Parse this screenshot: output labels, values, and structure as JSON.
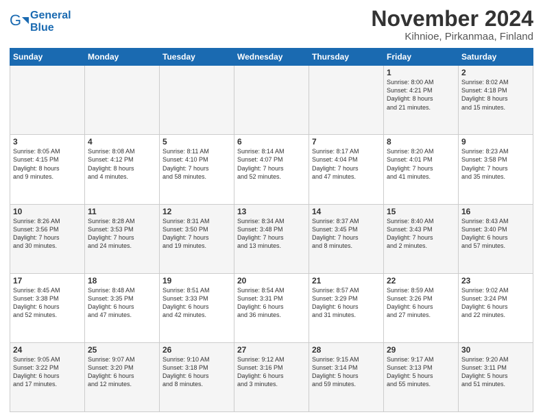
{
  "header": {
    "logo_line1": "General",
    "logo_line2": "Blue",
    "title": "November 2024",
    "subtitle": "Kihnioe, Pirkanmaa, Finland"
  },
  "weekdays": [
    "Sunday",
    "Monday",
    "Tuesday",
    "Wednesday",
    "Thursday",
    "Friday",
    "Saturday"
  ],
  "weeks": [
    [
      {
        "day": "",
        "info": ""
      },
      {
        "day": "",
        "info": ""
      },
      {
        "day": "",
        "info": ""
      },
      {
        "day": "",
        "info": ""
      },
      {
        "day": "",
        "info": ""
      },
      {
        "day": "1",
        "info": "Sunrise: 8:00 AM\nSunset: 4:21 PM\nDaylight: 8 hours\nand 21 minutes."
      },
      {
        "day": "2",
        "info": "Sunrise: 8:02 AM\nSunset: 4:18 PM\nDaylight: 8 hours\nand 15 minutes."
      }
    ],
    [
      {
        "day": "3",
        "info": "Sunrise: 8:05 AM\nSunset: 4:15 PM\nDaylight: 8 hours\nand 9 minutes."
      },
      {
        "day": "4",
        "info": "Sunrise: 8:08 AM\nSunset: 4:12 PM\nDaylight: 8 hours\nand 4 minutes."
      },
      {
        "day": "5",
        "info": "Sunrise: 8:11 AM\nSunset: 4:10 PM\nDaylight: 7 hours\nand 58 minutes."
      },
      {
        "day": "6",
        "info": "Sunrise: 8:14 AM\nSunset: 4:07 PM\nDaylight: 7 hours\nand 52 minutes."
      },
      {
        "day": "7",
        "info": "Sunrise: 8:17 AM\nSunset: 4:04 PM\nDaylight: 7 hours\nand 47 minutes."
      },
      {
        "day": "8",
        "info": "Sunrise: 8:20 AM\nSunset: 4:01 PM\nDaylight: 7 hours\nand 41 minutes."
      },
      {
        "day": "9",
        "info": "Sunrise: 8:23 AM\nSunset: 3:58 PM\nDaylight: 7 hours\nand 35 minutes."
      }
    ],
    [
      {
        "day": "10",
        "info": "Sunrise: 8:26 AM\nSunset: 3:56 PM\nDaylight: 7 hours\nand 30 minutes."
      },
      {
        "day": "11",
        "info": "Sunrise: 8:28 AM\nSunset: 3:53 PM\nDaylight: 7 hours\nand 24 minutes."
      },
      {
        "day": "12",
        "info": "Sunrise: 8:31 AM\nSunset: 3:50 PM\nDaylight: 7 hours\nand 19 minutes."
      },
      {
        "day": "13",
        "info": "Sunrise: 8:34 AM\nSunset: 3:48 PM\nDaylight: 7 hours\nand 13 minutes."
      },
      {
        "day": "14",
        "info": "Sunrise: 8:37 AM\nSunset: 3:45 PM\nDaylight: 7 hours\nand 8 minutes."
      },
      {
        "day": "15",
        "info": "Sunrise: 8:40 AM\nSunset: 3:43 PM\nDaylight: 7 hours\nand 2 minutes."
      },
      {
        "day": "16",
        "info": "Sunrise: 8:43 AM\nSunset: 3:40 PM\nDaylight: 6 hours\nand 57 minutes."
      }
    ],
    [
      {
        "day": "17",
        "info": "Sunrise: 8:45 AM\nSunset: 3:38 PM\nDaylight: 6 hours\nand 52 minutes."
      },
      {
        "day": "18",
        "info": "Sunrise: 8:48 AM\nSunset: 3:35 PM\nDaylight: 6 hours\nand 47 minutes."
      },
      {
        "day": "19",
        "info": "Sunrise: 8:51 AM\nSunset: 3:33 PM\nDaylight: 6 hours\nand 42 minutes."
      },
      {
        "day": "20",
        "info": "Sunrise: 8:54 AM\nSunset: 3:31 PM\nDaylight: 6 hours\nand 36 minutes."
      },
      {
        "day": "21",
        "info": "Sunrise: 8:57 AM\nSunset: 3:29 PM\nDaylight: 6 hours\nand 31 minutes."
      },
      {
        "day": "22",
        "info": "Sunrise: 8:59 AM\nSunset: 3:26 PM\nDaylight: 6 hours\nand 27 minutes."
      },
      {
        "day": "23",
        "info": "Sunrise: 9:02 AM\nSunset: 3:24 PM\nDaylight: 6 hours\nand 22 minutes."
      }
    ],
    [
      {
        "day": "24",
        "info": "Sunrise: 9:05 AM\nSunset: 3:22 PM\nDaylight: 6 hours\nand 17 minutes."
      },
      {
        "day": "25",
        "info": "Sunrise: 9:07 AM\nSunset: 3:20 PM\nDaylight: 6 hours\nand 12 minutes."
      },
      {
        "day": "26",
        "info": "Sunrise: 9:10 AM\nSunset: 3:18 PM\nDaylight: 6 hours\nand 8 minutes."
      },
      {
        "day": "27",
        "info": "Sunrise: 9:12 AM\nSunset: 3:16 PM\nDaylight: 6 hours\nand 3 minutes."
      },
      {
        "day": "28",
        "info": "Sunrise: 9:15 AM\nSunset: 3:14 PM\nDaylight: 5 hours\nand 59 minutes."
      },
      {
        "day": "29",
        "info": "Sunrise: 9:17 AM\nSunset: 3:13 PM\nDaylight: 5 hours\nand 55 minutes."
      },
      {
        "day": "30",
        "info": "Sunrise: 9:20 AM\nSunset: 3:11 PM\nDaylight: 5 hours\nand 51 minutes."
      }
    ]
  ]
}
